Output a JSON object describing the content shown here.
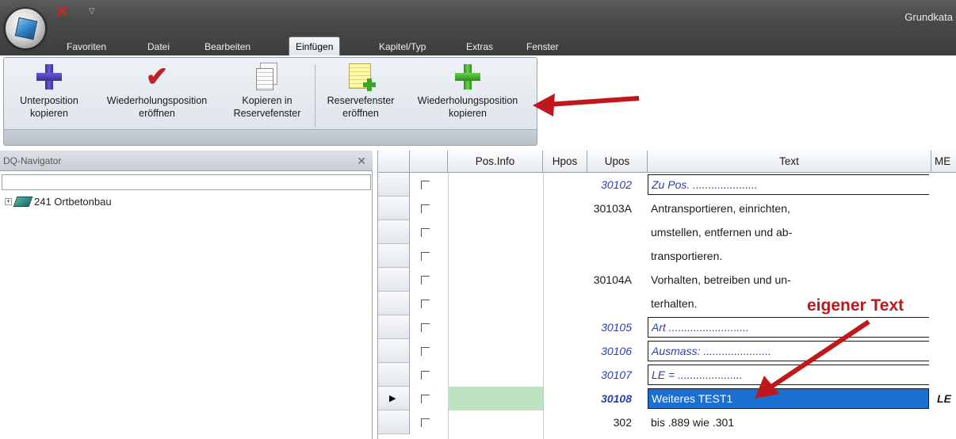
{
  "window": {
    "title": "Grundkata"
  },
  "menu_tabs": [
    {
      "label": "Favoriten"
    },
    {
      "label": "Datei"
    },
    {
      "label": "Bearbeiten"
    },
    {
      "label": "Einfügen"
    },
    {
      "label": "Kapitel/Typ"
    },
    {
      "label": "Extras"
    },
    {
      "label": "Fenster"
    }
  ],
  "active_tab": "Einfügen",
  "ribbon": {
    "buttons": [
      {
        "line1": "Unterposition",
        "line2": "kopieren",
        "icon": "blue-plus-icon"
      },
      {
        "line1": "Wiederholungsposition",
        "line2": "eröffnen",
        "icon": "red-check-icon"
      },
      {
        "line1": "Kopieren in",
        "line2": "Reservefenster",
        "icon": "documents-icon"
      },
      {
        "line1": "Reservefenster",
        "line2": "eröffnen",
        "icon": "note-plus-icon"
      },
      {
        "line1": "Wiederholungsposition",
        "line2": "kopieren",
        "icon": "green-plus-icon"
      }
    ]
  },
  "navigator": {
    "title": "DQ-Navigator",
    "close_glyph": "✕",
    "tree": [
      {
        "label": "241 Ortbetonbau",
        "expand": "+"
      }
    ]
  },
  "grid": {
    "columns": [
      "",
      "",
      "Pos.Info",
      "Hpos",
      "Upos",
      "Text",
      "ME"
    ],
    "rows": [
      {
        "upos": "30102",
        "text": "Zu Pos. .....................",
        "style": "blue-boxed"
      },
      {
        "upos": "30103A",
        "text": "Antransportieren, einrichten,",
        "style": "normal"
      },
      {
        "upos": "",
        "text": "umstellen, entfernen und ab-",
        "style": "normal"
      },
      {
        "upos": "",
        "text": "transportieren.",
        "style": "normal"
      },
      {
        "upos": "30104A",
        "text": "Vorhalten, betreiben und un-",
        "style": "normal"
      },
      {
        "upos": "",
        "text": "terhalten.",
        "style": "normal"
      },
      {
        "upos": "30105",
        "text": "Art ..........................",
        "style": "blue-boxed"
      },
      {
        "upos": "30106",
        "text": "Ausmass: ......................",
        "style": "blue-boxed"
      },
      {
        "upos": "30107",
        "text": "LE = .....................",
        "style": "blue-boxed"
      },
      {
        "upos": "30108",
        "text": "Weiteres TEST1",
        "style": "selected",
        "me": "LE",
        "current": true
      },
      {
        "upos": "302",
        "text": "bis .889 wie .301",
        "style": "normal"
      }
    ]
  },
  "annotation": {
    "label": "eigener Text",
    "color": "#c0171c"
  }
}
